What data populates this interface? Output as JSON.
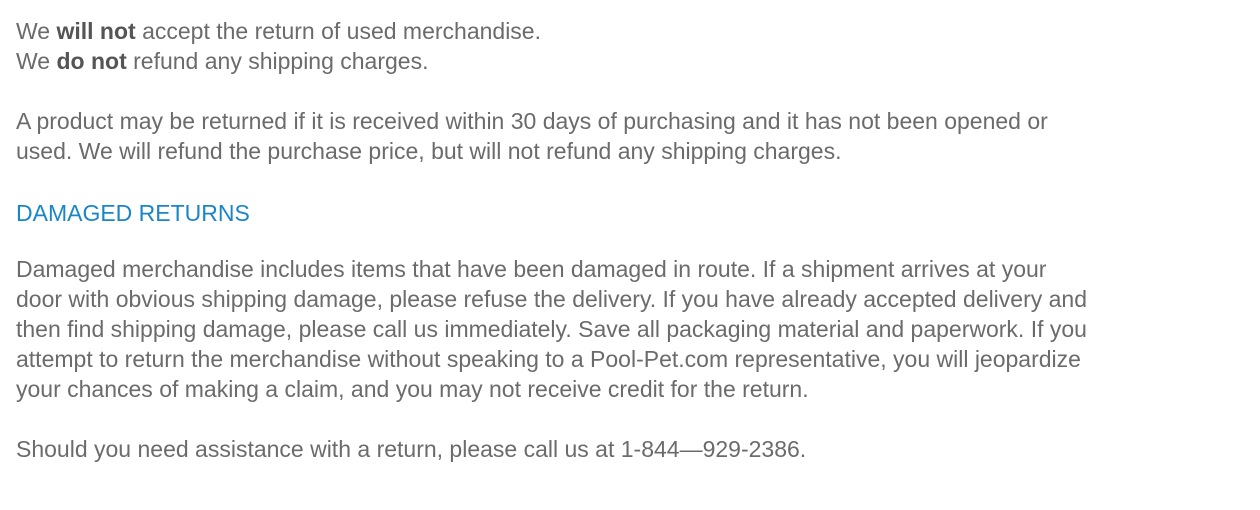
{
  "policy_lines": {
    "line1": {
      "pre": "We ",
      "bold": "will not",
      "post": " accept the return of used merchandise."
    },
    "line2": {
      "pre": "We ",
      "bold": "do not",
      "post": " refund any shipping charges."
    }
  },
  "return_paragraph": [
    "A product may be returned if it is received within 30 days of purchasing and it has not been opened or",
    "used.  We will refund the purchase price, but will not refund any shipping charges."
  ],
  "damaged_heading": "DAMAGED RETURNS",
  "damaged_paragraph": [
    "Damaged merchandise includes items that have been damaged in route. If a shipment arrives at your",
    "door with obvious shipping damage, please refuse the delivery. If you have already accepted delivery and",
    "then find shipping damage, please call us immediately. Save all packaging material and paperwork. If you",
    "attempt to return the merchandise without speaking to a Pool-Pet.com representative, you will jeopardize",
    "your chances of making a claim, and you may not receive credit for the return."
  ],
  "assistance_text": "Should you need assistance with a return, please call us at 1-844—929-2386.",
  "colors": {
    "body_text": "#6b6b6b",
    "heading": "#1a86c8"
  }
}
